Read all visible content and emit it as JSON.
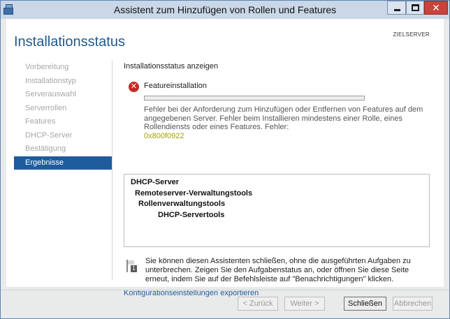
{
  "window": {
    "title": "Assistent zum Hinzufügen von Rollen und Features",
    "close_glyph": "✕"
  },
  "header": {
    "page_title": "Installationsstatus",
    "target_server": "ZIELSERVER"
  },
  "nav": {
    "items": [
      {
        "label": "Vorbereitung",
        "active": false
      },
      {
        "label": "Installationstyp",
        "active": false
      },
      {
        "label": "Serverauswahl",
        "active": false
      },
      {
        "label": "Serverrollen",
        "active": false
      },
      {
        "label": "Features",
        "active": false
      },
      {
        "label": "DHCP-Server",
        "active": false
      },
      {
        "label": "Bestätigung",
        "active": false
      },
      {
        "label": "Ergebnisse",
        "active": true
      }
    ]
  },
  "content": {
    "heading": "Installationsstatus anzeigen",
    "feature_install_label": "Featureinstallation",
    "progress_percent": 0,
    "error_message": "Fehler bei der Anforderung zum Hinzufügen oder Entfernen von Features auf dem angegebenen Server. Fehler beim Installieren mindestens einer Rolle, eines Rollendiensts oder eines Features. Fehler:",
    "error_code": "0x800f0922",
    "results": [
      {
        "label": "DHCP-Server",
        "level": 0
      },
      {
        "label": "Remoteserver-Verwaltungstools",
        "level": 1
      },
      {
        "label": "Rollenverwaltungstools",
        "level": 2
      },
      {
        "label": "DHCP-Servertools",
        "level": 3
      }
    ],
    "flag_number": "1",
    "info_text": "Sie können diesen Assistenten schließen, ohne die ausgeführten Aufgaben zu unterbrechen. Zeigen Sie den Aufgabenstatus an, oder öffnen Sie diese Seite erneut, indem Sie auf der Befehlsleiste auf \"Benachrichtigungen\" klicken.",
    "export_link": "Konfigurationseinstellungen exportieren"
  },
  "footer": {
    "back_label": "< Zurück",
    "next_label": "Weiter >",
    "close_label": "Schließen",
    "cancel_label": "Abbrechen"
  },
  "colors": {
    "accent": "#1e5c9c",
    "error": "#c52a24",
    "error_code": "#a1a100",
    "progress": "#06b025"
  }
}
